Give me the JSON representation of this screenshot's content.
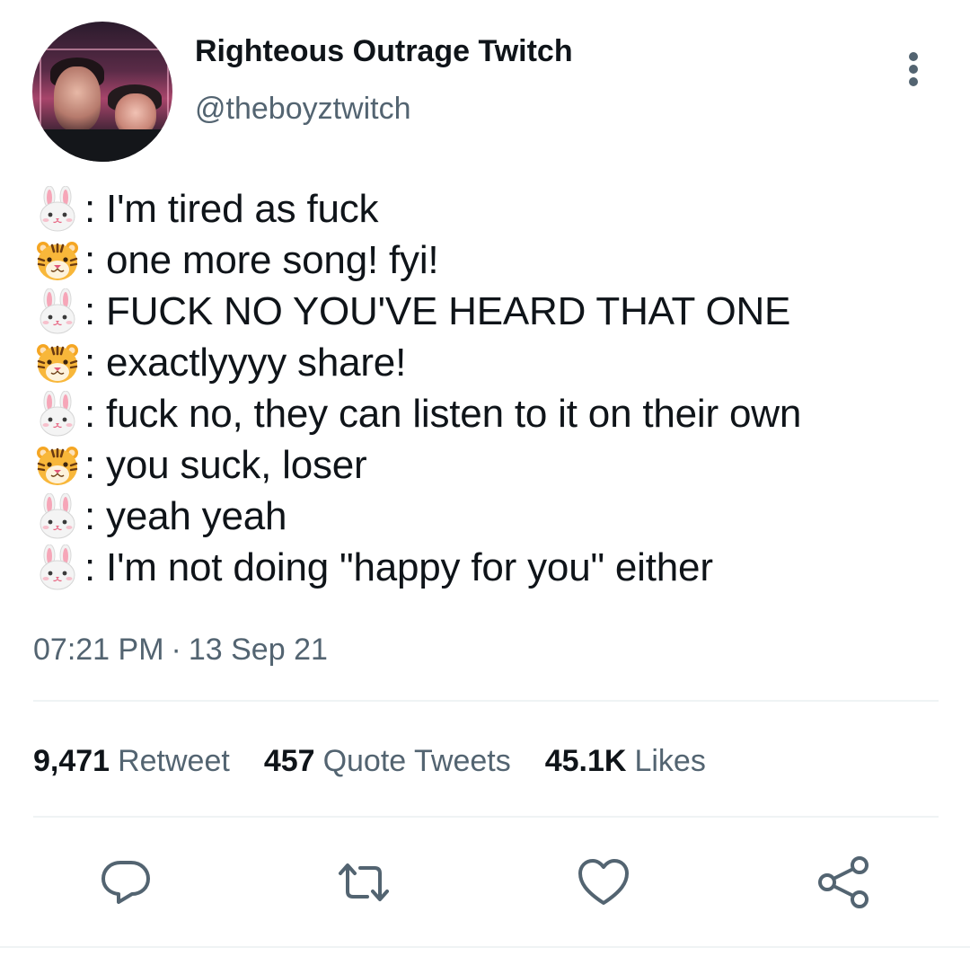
{
  "author": {
    "display_name": "Righteous Outrage Twitch",
    "handle": "@theboyztwitch"
  },
  "tweet": {
    "lines": [
      {
        "speaker_icon": "rabbit-face-icon",
        "text": ": I'm tired as fuck"
      },
      {
        "speaker_icon": "tiger-face-icon",
        "text": ": one more song! fyi!"
      },
      {
        "speaker_icon": "rabbit-face-icon",
        "text": ": FUCK NO YOU'VE HEARD THAT ONE"
      },
      {
        "speaker_icon": "tiger-face-icon",
        "text": ": exactlyyyy share!"
      },
      {
        "speaker_icon": "rabbit-face-icon",
        "text": ": fuck no, they can listen to it on their own"
      },
      {
        "speaker_icon": "tiger-face-icon",
        "text": ": you suck, loser"
      },
      {
        "speaker_icon": "rabbit-face-icon",
        "text": ": yeah yeah"
      },
      {
        "speaker_icon": "rabbit-face-icon",
        "text": ": I'm not doing \"happy for you\" either"
      }
    ],
    "time": "07:21 PM",
    "separator": "·",
    "date": "13 Sep 21"
  },
  "stats": {
    "retweets_count": "9,471",
    "retweets_label": "Retweet",
    "quotes_count": "457",
    "quotes_label": "Quote Tweets",
    "likes_count": "45.1K",
    "likes_label": "Likes"
  },
  "actions": {
    "reply_icon": "reply-icon",
    "retweet_icon": "retweet-icon",
    "like_icon": "heart-icon",
    "share_icon": "share-icon"
  },
  "colors": {
    "text_primary": "#0f1419",
    "text_secondary": "#536471",
    "divider": "#eff3f4",
    "icon": "#536471"
  }
}
